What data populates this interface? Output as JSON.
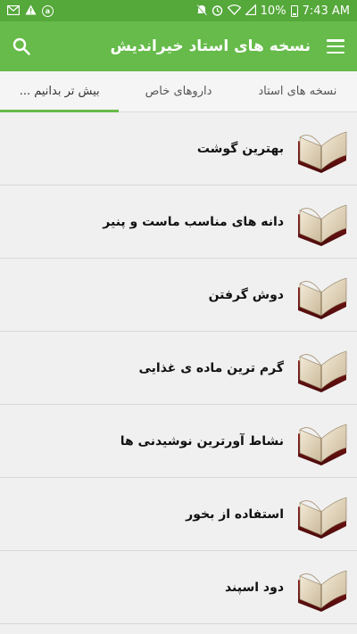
{
  "status_bar": {
    "battery": "10%",
    "time": "7:43 AM",
    "left_icons": [
      "gmail-icon",
      "alert-icon",
      "notification-icon"
    ],
    "right_icons": [
      "mute-icon",
      "alarm-icon",
      "wifi-icon",
      "signal-icon",
      "battery-icon"
    ]
  },
  "app_bar": {
    "title": "نسخه های استاد خیراندیش",
    "search_icon": "search-icon",
    "menu_icon": "menu-icon"
  },
  "tabs": [
    {
      "label": "بیش تر بدانیم ...",
      "active": true
    },
    {
      "label": "داروهای خاص",
      "active": false
    },
    {
      "label": "نسخه های استاد",
      "active": false
    }
  ],
  "list": {
    "items": [
      {
        "label": "بهترین گوشت"
      },
      {
        "label": "دانه های مناسب ماست و پنیر"
      },
      {
        "label": "دوش گرفتن"
      },
      {
        "label": "گرم ترین ماده ی غذایی"
      },
      {
        "label": "نشاط آورترین نوشیدنی ها"
      },
      {
        "label": "استفاده از بخور"
      },
      {
        "label": "دود اسپند"
      }
    ],
    "item_icon": "book-icon"
  },
  "colors": {
    "status_bar": "#55a83a",
    "app_bar": "#66bb4a",
    "accent": "#66bb4a",
    "list_background": "#f0f0f0"
  }
}
